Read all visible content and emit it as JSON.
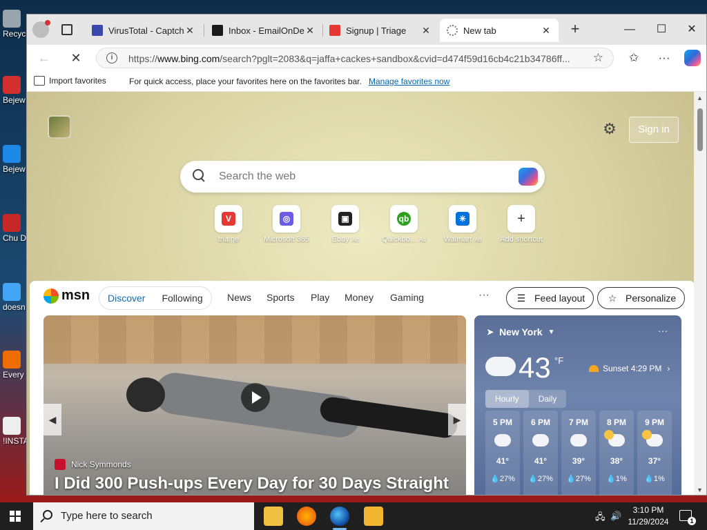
{
  "desktop": {
    "icons": [
      {
        "label": "Recyc"
      },
      {
        "label": "Bejew Del"
      },
      {
        "label": "Bejew Del"
      },
      {
        "label": "Chu Del"
      },
      {
        "label": "doesn"
      },
      {
        "label": "Every"
      },
      {
        "label": "!INSTA"
      }
    ]
  },
  "browser": {
    "tabs": [
      {
        "label": "VirusTotal - Captcha",
        "color": "#3949ab"
      },
      {
        "label": "Inbox - EmailOnDeck",
        "color": "#1a1a1a"
      },
      {
        "label": "Signup | Triage",
        "color": "#e53935"
      },
      {
        "label": "New tab",
        "color": "#777777"
      }
    ],
    "address": {
      "prefix": "https://",
      "host": "www.bing.com",
      "path": "/search?pglt=2083&q=jaffa+cackes+sandbox&cvid=d474f59d16cb4c21b34786ff..."
    },
    "favorites_bar": {
      "import_label": "Import favorites",
      "message": "For quick access, place your favorites here on the favorites bar.",
      "manage_link": "Manage favorites now"
    }
  },
  "newtab": {
    "sign_in": "Sign in",
    "search_placeholder": "Search the web",
    "shortcuts": [
      {
        "label": "tria.ge",
        "ad": "",
        "color": "#e53935",
        "glyph": "V"
      },
      {
        "label": "Microsoft 365",
        "ad": "",
        "color": "#6b5be6",
        "glyph": "◎"
      },
      {
        "label": "Ebay",
        "ad": "Ad",
        "color": "#222222",
        "glyph": "▣"
      },
      {
        "label": "Quickbo...",
        "ad": "Ad",
        "color": "#2ca01c",
        "glyph": "qb"
      },
      {
        "label": "Walmart",
        "ad": "Ad",
        "color": "#0071dc",
        "glyph": "✳"
      },
      {
        "label": "Add shortcut",
        "ad": "",
        "color": "#ffffff",
        "glyph": "+"
      }
    ]
  },
  "msn": {
    "logo": "msn",
    "tabs": [
      "Discover",
      "Following"
    ],
    "nav": [
      "News",
      "Sports",
      "Play",
      "Money",
      "Gaming"
    ],
    "more": "···",
    "feed_layout": "Feed layout",
    "personalize": "Personalize",
    "hero": {
      "source": "Nick Symmonds",
      "headline": "I Did 300 Push-ups Every Day for 30 Days Straight"
    },
    "weather": {
      "location": "New York",
      "temp": "43",
      "unit": "°F",
      "sunset": "Sunset 4:29 PM",
      "tabs": [
        "Hourly",
        "Daily"
      ],
      "hours": [
        {
          "time": "5 PM",
          "temp": "41°",
          "precip": "27%",
          "icon": "cloudy-icon"
        },
        {
          "time": "6 PM",
          "temp": "41°",
          "precip": "27%",
          "icon": "cloudy-icon"
        },
        {
          "time": "7 PM",
          "temp": "39°",
          "precip": "27%",
          "icon": "cloudy-icon"
        },
        {
          "time": "8 PM",
          "temp": "38°",
          "precip": "1%",
          "icon": "partly-cloudy-night-icon"
        },
        {
          "time": "9 PM",
          "temp": "37°",
          "precip": "1%",
          "icon": "partly-cloudy-night-icon"
        }
      ]
    }
  },
  "taskbar": {
    "search_placeholder": "Type here to search",
    "time": "3:10 PM",
    "date": "11/29/2024",
    "notifications": "1"
  }
}
